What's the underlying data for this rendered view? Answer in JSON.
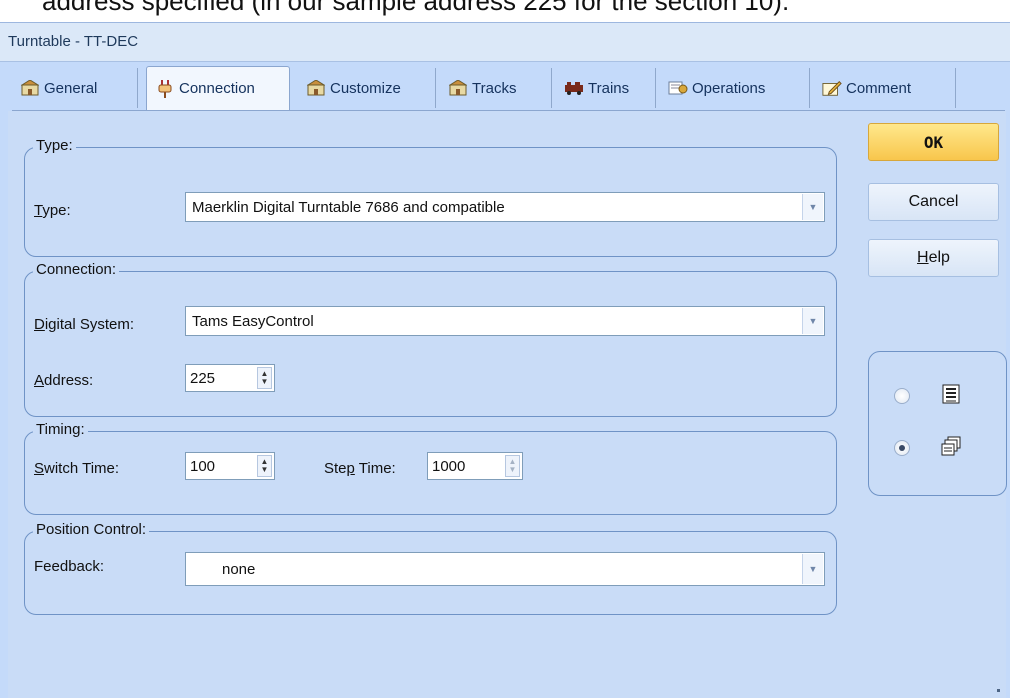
{
  "caption": "address specified (in our sample address 225 for the section 10).",
  "window": {
    "title": "Turntable - TT-DEC"
  },
  "tabs": [
    {
      "label": "General",
      "icon": "general-icon"
    },
    {
      "label": "Connection",
      "icon": "plug-icon",
      "active": true
    },
    {
      "label": "Customize",
      "icon": "customize-icon"
    },
    {
      "label": "Tracks",
      "icon": "tracks-icon"
    },
    {
      "label": "Trains",
      "icon": "train-icon"
    },
    {
      "label": "Operations",
      "icon": "operations-icon"
    },
    {
      "label": "Comment",
      "icon": "pencil-icon"
    }
  ],
  "type_group": {
    "title": "Type:",
    "type_label": "Type:",
    "type_value": "Maerklin Digital Turntable 7686 and compatible"
  },
  "connection_group": {
    "title": "Connection:",
    "system_label": "Digital System:",
    "system_value": "Tams EasyControl",
    "address_label": "Address:",
    "address_value": "225"
  },
  "timing_group": {
    "title": "Timing:",
    "switch_label": "Switch Time:",
    "switch_value": "100",
    "step_label": "Step Time:",
    "step_value": "1000"
  },
  "position_group": {
    "title": "Position Control:",
    "feedback_label": "Feedback:",
    "feedback_value": "none"
  },
  "buttons": {
    "ok": "OK",
    "cancel": "Cancel",
    "help": "Help"
  },
  "view_options": [
    {
      "icon": "list-view-icon",
      "checked": false
    },
    {
      "icon": "window-view-icon",
      "checked": true
    }
  ],
  "colors": {
    "window_bg": "#c9dcf7",
    "ok_button": "#f8c64c",
    "group_border": "#6f93c6"
  }
}
